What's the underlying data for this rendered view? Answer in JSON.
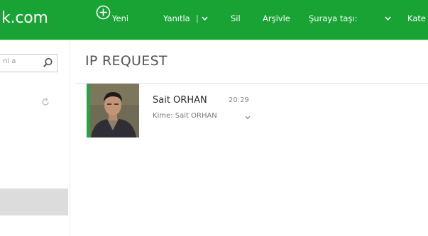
{
  "brand": {
    "text": "k.com"
  },
  "toolbar": {
    "new_label": "Yeni",
    "reply_label": "Yanıtla",
    "reply_separator": "|",
    "delete_label": "Sil",
    "archive_label": "Arşivle",
    "move_label": "Şuraya taşı:",
    "category_label": "Kate"
  },
  "search": {
    "text": "ni a"
  },
  "message": {
    "subject": "IP REQUEST",
    "sender": "Sait ORHAN",
    "time": "20:29",
    "recipients": "Kime: Sait ORHAN"
  },
  "colors": {
    "brand": "#18a334",
    "avatar_accent": "#27a244",
    "selected_row": "#dcdcdc"
  },
  "icons": [
    "plus-circle-icon",
    "chevron-down-icon",
    "search-icon",
    "refresh-icon"
  ]
}
